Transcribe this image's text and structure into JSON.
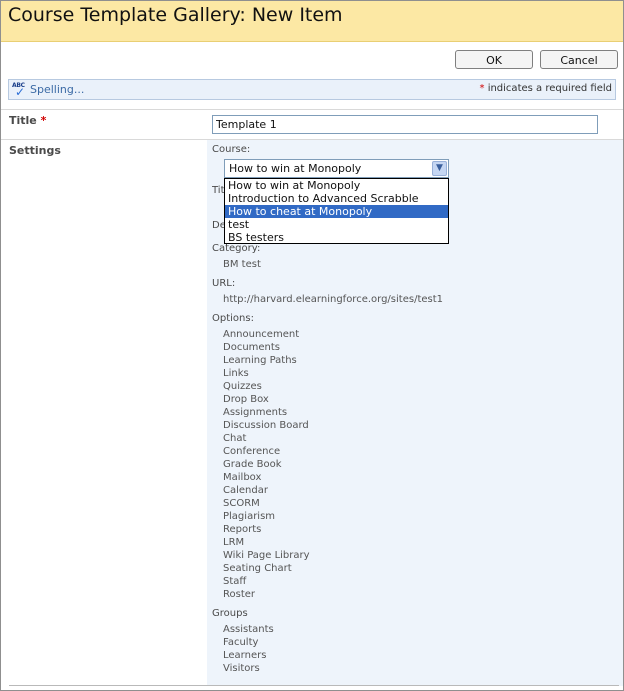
{
  "header": {
    "title": "Course Template Gallery: New Item"
  },
  "actions": {
    "ok_label": "OK",
    "cancel_label": "Cancel"
  },
  "toolbar": {
    "spelling_label": "Spelling...",
    "required_asterisk": "*",
    "required_note": " indicates a required field"
  },
  "form": {
    "title_label": "Title",
    "title_asterisk": "*",
    "title_value": "Template 1",
    "settings_label": "Settings",
    "course_label": "Course:",
    "course_selected": "How to win at Monopoly",
    "course_options": [
      "How to win at Monopoly",
      "Introduction to Advanced Scrabble",
      "How to cheat at Monopoly",
      "test",
      "BS testers"
    ],
    "highlighted_option_index": 2,
    "hidden_label_1": "Title:",
    "hidden_label_2": "Description:",
    "category_label": "Category:",
    "category_value": "BM test",
    "url_label": "URL:",
    "url_value": "http://harvard.elearningforce.org/sites/test1",
    "options_label": "Options:",
    "options": [
      "Announcement",
      "Documents",
      "Learning Paths",
      "Links",
      "Quizzes",
      "Drop Box",
      "Assignments",
      "Discussion Board",
      "Chat",
      "Conference",
      "Grade Book",
      "Mailbox",
      "Calendar",
      "SCORM",
      "Plagiarism",
      "Reports",
      "LRM",
      "Wiki Page Library",
      "Seating Chart",
      "Staff",
      "Roster"
    ],
    "groups_label": "Groups",
    "groups": [
      "Assistants",
      "Faculty",
      "Learners",
      "Visitors"
    ]
  },
  "colors": {
    "title_bar_bg": "#fce8a4",
    "settings_bg": "#eef4fb",
    "selection_bg": "#316ac5",
    "required_red": "#d00000"
  },
  "icons": {
    "spelling": "spell-check-icon",
    "dropdown": "chevron-down-icon"
  }
}
